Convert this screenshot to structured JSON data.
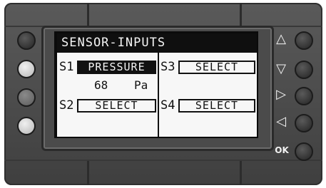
{
  "screen": {
    "title": "SENSOR-INPUTS",
    "slots": [
      {
        "id": "S1",
        "value": "PRESSURE",
        "selected": true,
        "reading": {
          "number": "68",
          "unit": "Pa"
        }
      },
      {
        "id": "S2",
        "value": "SELECT",
        "selected": false
      },
      {
        "id": "S3",
        "value": "SELECT",
        "selected": false
      },
      {
        "id": "S4",
        "value": "SELECT",
        "selected": false
      }
    ]
  },
  "controls": {
    "left_buttons": [
      {
        "name": "left-button-1",
        "state": "dark"
      },
      {
        "name": "left-button-2",
        "state": "light"
      },
      {
        "name": "left-button-3",
        "state": "dim"
      },
      {
        "name": "left-button-4",
        "state": "light"
      }
    ],
    "right_buttons": [
      {
        "icon": "triangle-up-icon",
        "glyph": "△"
      },
      {
        "icon": "triangle-down-icon",
        "glyph": "▽"
      },
      {
        "icon": "triangle-right-icon",
        "glyph": "▷"
      },
      {
        "icon": "triangle-left-icon",
        "glyph": "◁"
      },
      {
        "icon": "ok-label",
        "glyph": "OK"
      }
    ]
  },
  "colors": {
    "housing": "#4a4a4a",
    "screen_background": "#f7f7f7",
    "screen_ink": "#111111"
  }
}
